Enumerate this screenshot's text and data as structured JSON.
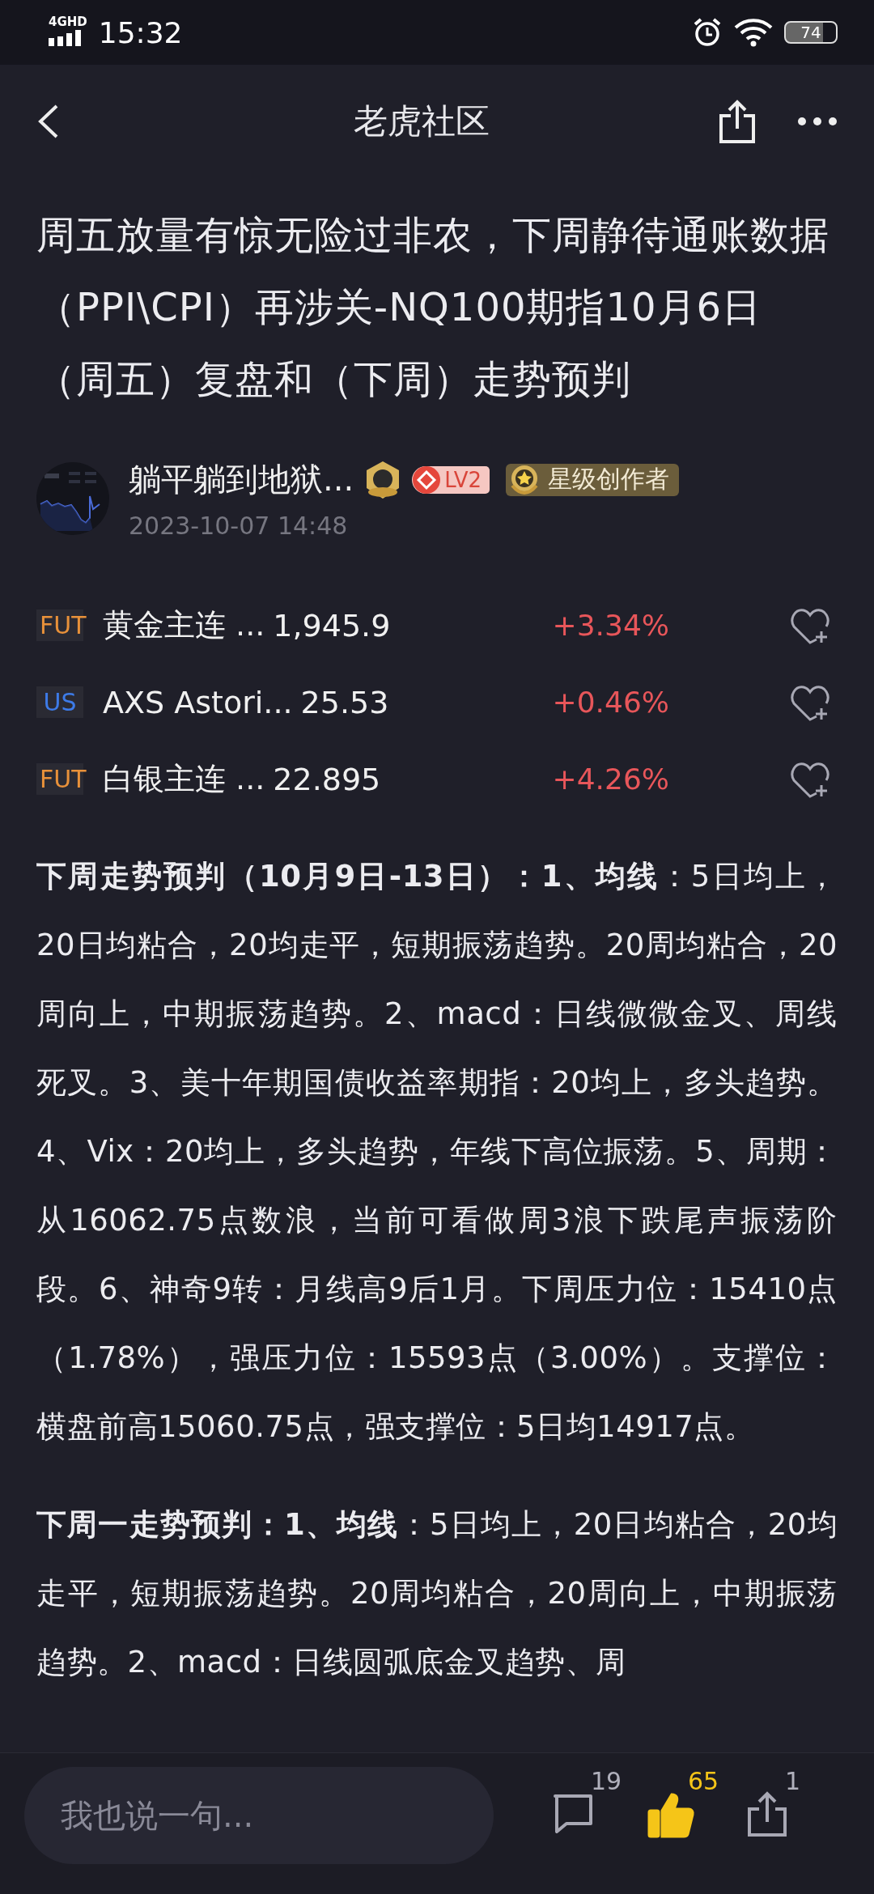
{
  "status_bar": {
    "network": "4GHD",
    "time": "15:32",
    "battery": "74"
  },
  "header": {
    "title": "老虎社区"
  },
  "article": {
    "title": "周五放量有惊无险过非农，下周静待通账数据（PPI\\CPI）再涉关-NQ100期指10月6日（周五）复盘和（下周）走势预判",
    "author": {
      "name": "躺平躺到地狱...",
      "level": "LV2",
      "badge": "星级创作者",
      "date": "2023-10-07 14:48"
    },
    "stocks": [
      {
        "market": "FUT",
        "color": "#e8913a",
        "name": "黄金主连 ...",
        "price": "1,945.9",
        "change": "+3.34%"
      },
      {
        "market": "US",
        "color": "#3d7be8",
        "name": "AXS Astori...",
        "price": "25.53",
        "change": "+0.46%"
      },
      {
        "market": "FUT",
        "color": "#e8913a",
        "name": "白银主连 ...",
        "price": "22.895",
        "change": "+4.26%"
      }
    ],
    "paragraphs": [
      "**下周走势预判（10月9日-13日）：1、均线**：5日均上，20日均粘合，20均走平，短期振荡趋势。20周均粘合，20周向上，中期振荡趋势。2、macd：日线微微金叉、周线死叉。3、美十年期国债收益率期指：20均上，多头趋势。4、Vix：20均上，多头趋势，年线下高位振荡。5、周期：从16062.75点数浪，当前可看做周3浪下跌尾声振荡阶段。6、神奇9转：月线高9后1月。下周压力位：15410点（1.78%），强压力位：15593点（3.00%）。支撑位：横盘前高15060.75点，强支撑位：5日均14917点。",
      "**下周一走势预判：1、均线**：5日均上，20日均粘合，20均走平，短期振荡趋势。20周均粘合，20周向上，中期振荡趋势。2、macd：日线圆弧底金叉趋势、周"
    ]
  },
  "bottom_bar": {
    "placeholder": "我也说一句...",
    "comments": "19",
    "likes": "65",
    "liked": true,
    "shares": "1"
  }
}
